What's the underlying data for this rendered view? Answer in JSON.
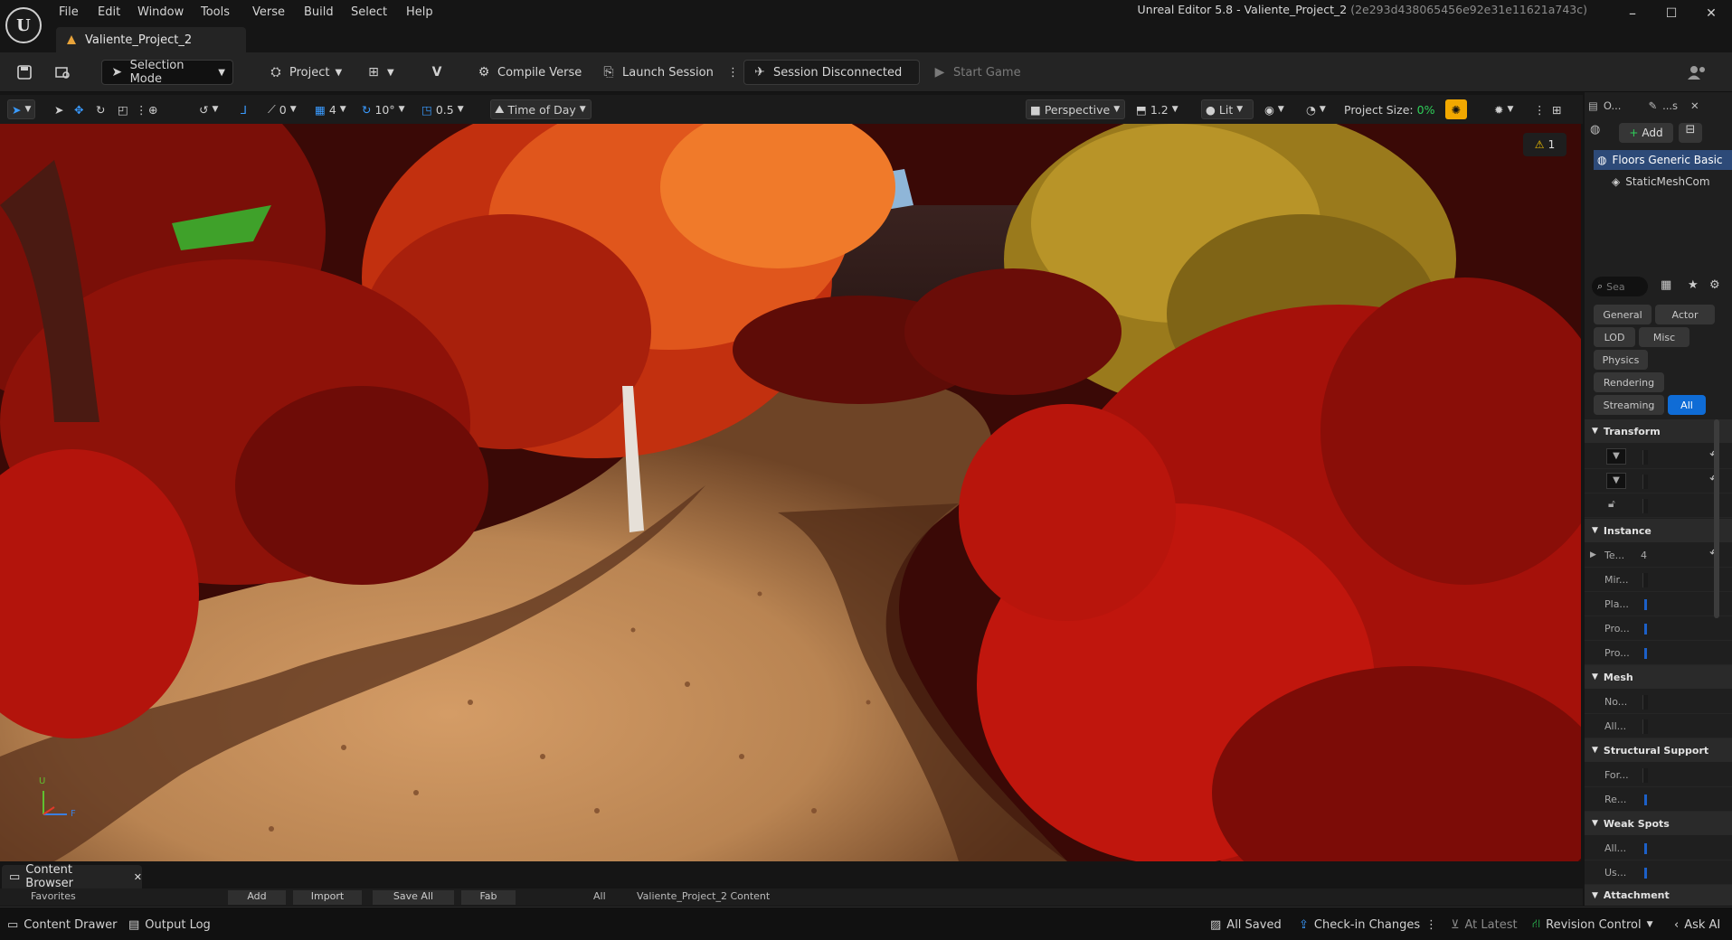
{
  "app": {
    "logo": "U",
    "window_title": "Unreal Editor 5.8 - Valiente_Project_2",
    "window_hash": "(2e293d438065456e92e31e11621a743c)",
    "doc_tab": "Valiente_Project_2",
    "menus": [
      "File",
      "Edit",
      "Window",
      "Tools",
      "Verse",
      "Build",
      "Select",
      "Help"
    ],
    "win_controls": {
      "minimize": "–",
      "maximize": "☐",
      "close": "✕"
    }
  },
  "toolbar": {
    "selection_mode": "Selection Mode",
    "project": "Project",
    "compile_verse": "Compile Verse",
    "launch_session": "Launch Session",
    "session_status": "Session Disconnected",
    "start_game": "Start Game"
  },
  "viewport_toolbar": {
    "rotation_snap": "0",
    "grid_snap": "4",
    "angle_snap": "10°",
    "scale_snap": "0.5",
    "time_of_day": "Time of Day",
    "perspective": "Perspective",
    "camera_speed": "1.2",
    "view_mode": "Lit",
    "project_size_label": "Project Size:",
    "project_size_value": "0%"
  },
  "viewport": {
    "warning_count": "1",
    "axis_up": "U",
    "axis_forward": "F",
    "colors": {
      "sky": "#8fb6d8",
      "path": "#c9915c",
      "foliage": "#b3140c",
      "olive": "#9a7a1c"
    }
  },
  "outliner": {
    "tab_label": "O...",
    "details_tab": "...s",
    "add_button": "Add",
    "items": [
      "Floors Generic Basic",
      "StaticMeshCom"
    ]
  },
  "details": {
    "search_placeholder": "Sea",
    "categories": [
      "General",
      "Actor",
      "LOD",
      "Misc",
      "Physics",
      "Rendering",
      "Streaming",
      "All"
    ],
    "sections": {
      "transform": "Transform",
      "instance": "Instance",
      "mesh": "Mesh",
      "structural_support": "Structural Support",
      "weak_spots": "Weak Spots",
      "attachment": "Attachment"
    },
    "instance_props": [
      "Te...",
      "Mir...",
      "Pla...",
      "Pro...",
      "Pro..."
    ],
    "instance_value": "4",
    "mesh_props": [
      "No...",
      "All..."
    ],
    "structural_props": [
      "For...",
      "Re..."
    ],
    "weak_props": [
      "All...",
      "Us..."
    ]
  },
  "content_browser": {
    "tab_label": "Content Browser",
    "strip": [
      "Favorites",
      "Add",
      "Import",
      "Save All",
      "Fab",
      "All",
      "Valiente_Project_2 Content"
    ]
  },
  "status_bar": {
    "content_drawer": "Content Drawer",
    "output_log": "Output Log",
    "all_saved": "All Saved",
    "check_in": "Check-in Changes",
    "at_latest": "At Latest",
    "revision_control": "Revision Control",
    "ask_ai": "Ask AI"
  }
}
